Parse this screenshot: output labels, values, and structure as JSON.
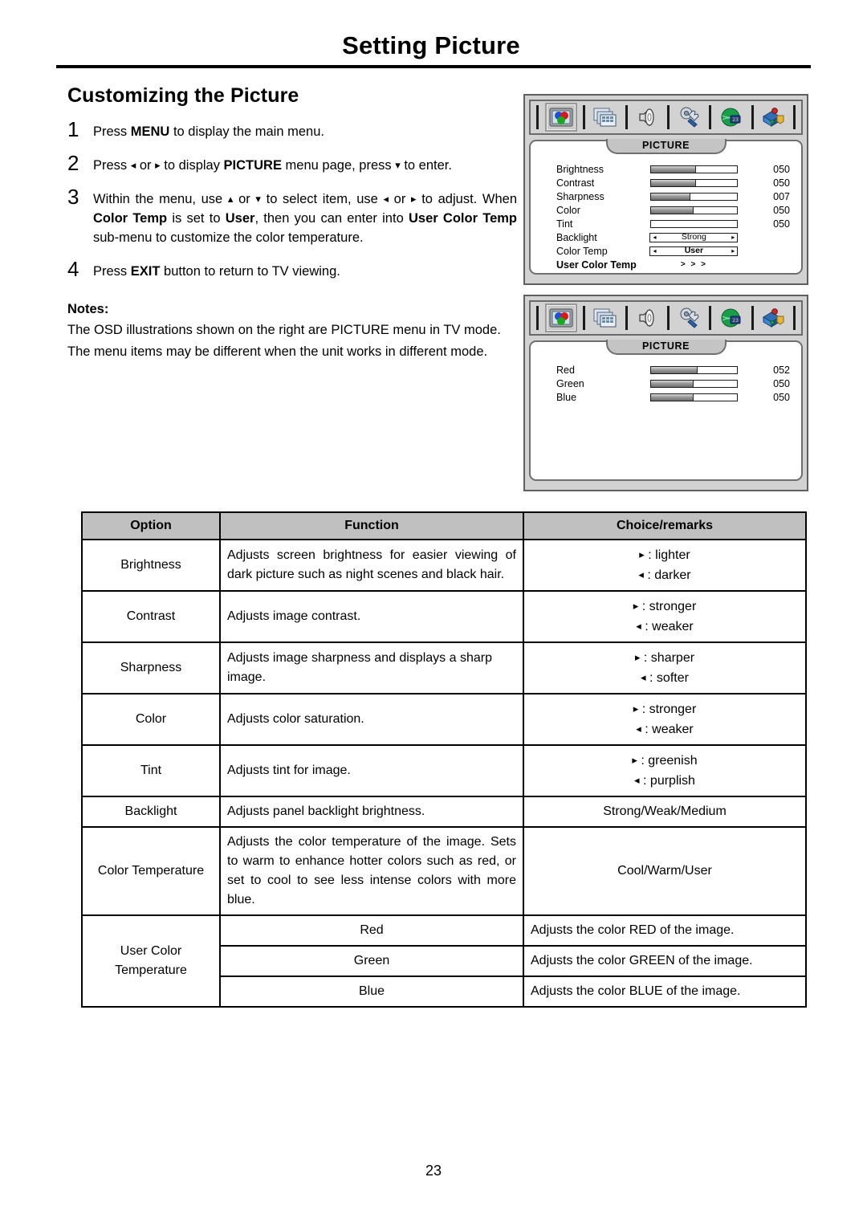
{
  "header": {
    "title": "Setting Picture"
  },
  "section": {
    "title": "Customizing the Picture"
  },
  "steps": [
    {
      "num": "1",
      "parts": [
        {
          "t": "Press ",
          "b": false
        },
        {
          "t": "MENU",
          "b": true
        },
        {
          "t": " to display the main menu.",
          "b": false
        }
      ]
    },
    {
      "num": "2",
      "parts": [
        {
          "t": "Press ",
          "b": false
        },
        {
          "t": "◂",
          "b": false,
          "arrow": true
        },
        {
          "t": " or ",
          "b": false
        },
        {
          "t": "▸",
          "b": false,
          "arrow": true
        },
        {
          "t": " to display ",
          "b": false
        },
        {
          "t": "PICTURE",
          "b": true
        },
        {
          "t": " menu page, press ",
          "b": false
        },
        {
          "t": "▾",
          "b": false,
          "arrow": true
        },
        {
          "t": " to enter.",
          "b": false
        }
      ]
    },
    {
      "num": "3",
      "parts": [
        {
          "t": "Within the menu, use ",
          "b": false
        },
        {
          "t": "▴",
          "b": false,
          "arrow": true
        },
        {
          "t": " or ",
          "b": false
        },
        {
          "t": "▾",
          "b": false,
          "arrow": true
        },
        {
          "t": " to select item, use ",
          "b": false
        },
        {
          "t": "◂",
          "b": false,
          "arrow": true
        },
        {
          "t": " or ",
          "b": false
        },
        {
          "t": "▸",
          "b": false,
          "arrow": true
        },
        {
          "t": " to adjust. When ",
          "b": false
        },
        {
          "t": "Color Temp",
          "b": true
        },
        {
          "t": " is set to ",
          "b": false
        },
        {
          "t": "User",
          "b": true
        },
        {
          "t": ", then you can enter into ",
          "b": false
        },
        {
          "t": "User Color Temp",
          "b": true
        },
        {
          "t": " sub-menu to customize the color temperature.",
          "b": false
        }
      ]
    },
    {
      "num": "4",
      "parts": [
        {
          "t": "Press ",
          "b": false
        },
        {
          "t": "EXIT",
          "b": true
        },
        {
          "t": " button to return to TV viewing.",
          "b": false
        }
      ]
    }
  ],
  "notes": {
    "label": "Notes",
    "lines": [
      "The OSD illustrations shown on the right are PICTURE menu in TV mode.",
      "The menu items may be different when the unit works in different mode."
    ]
  },
  "osd": {
    "icons": [
      {
        "name": "picture-icon",
        "selected": true
      },
      {
        "name": "channel-icon",
        "selected": false
      },
      {
        "name": "sound-icon",
        "selected": false
      },
      {
        "name": "setup-icon",
        "selected": false
      },
      {
        "name": "time-icon",
        "selected": false
      },
      {
        "name": "parental-icon",
        "selected": false
      }
    ],
    "panel1": {
      "tab_label": "PICTURE",
      "rows": [
        {
          "label": "Brightness",
          "type": "slider",
          "fill": 52,
          "value": "050",
          "bold": false
        },
        {
          "label": "Contrast",
          "type": "slider",
          "fill": 52,
          "value": "050",
          "bold": false
        },
        {
          "label": "Sharpness",
          "type": "slider",
          "fill": 46,
          "value": "007",
          "bold": false
        },
        {
          "label": "Color",
          "type": "slider",
          "fill": 50,
          "value": "050",
          "bold": false
        },
        {
          "label": "Tint",
          "type": "slider",
          "fill": 0,
          "value": "050",
          "bold": false
        },
        {
          "label": "Backlight",
          "type": "select",
          "value": "Strong",
          "bold": false,
          "value_bold": false
        },
        {
          "label": "Color Temp",
          "type": "select",
          "value": "User",
          "bold": false,
          "value_bold": true
        },
        {
          "label": "User Color Temp",
          "type": "chevron",
          "value": "> > >",
          "bold": true
        }
      ]
    },
    "panel2": {
      "tab_label": "PICTURE",
      "rows": [
        {
          "label": "Red",
          "type": "slider",
          "fill": 54,
          "value": "052",
          "bold": false
        },
        {
          "label": "Green",
          "type": "slider",
          "fill": 50,
          "value": "050",
          "bold": false
        },
        {
          "label": "Blue",
          "type": "slider",
          "fill": 50,
          "value": "050",
          "bold": false
        }
      ]
    }
  },
  "table": {
    "headers": [
      "Option",
      "Function",
      "Choice/remarks"
    ],
    "rows": [
      {
        "option": "Brightness",
        "function": "Adjusts screen brightness for easier viewing of dark picture such as night scenes and black hair.",
        "justify": true,
        "choices": [
          "▸ : lighter",
          "◂ : darker"
        ]
      },
      {
        "option": "Contrast",
        "function": "Adjusts image contrast.",
        "justify": false,
        "choices": [
          "▸ : stronger",
          "◂ : weaker"
        ]
      },
      {
        "option": "Sharpness",
        "function": "Adjusts image sharpness and displays a sharp image.",
        "justify": false,
        "choices": [
          "▸ : sharper",
          "◂ : softer"
        ]
      },
      {
        "option": "Color",
        "function": "Adjusts color saturation.",
        "justify": false,
        "choices": [
          "▸ : stronger",
          "◂ : weaker"
        ]
      },
      {
        "option": "Tint",
        "function": "Adjusts tint for image.",
        "justify": false,
        "choices": [
          "▸ : greenish",
          "◂ : purplish"
        ]
      },
      {
        "option": "Backlight",
        "function": "Adjusts panel backlight brightness.",
        "justify": false,
        "choices": [
          "Strong/Weak/Medium"
        ]
      },
      {
        "option": "Color Temperature",
        "function": "Adjusts the color temperature of the image. Sets to warm to enhance hotter colors such as red, or set to cool to see less intense colors with more blue.",
        "justify": true,
        "choices": [
          "Cool/Warm/User"
        ]
      }
    ],
    "user_color_group": {
      "label": "User Color Temperature",
      "subrows": [
        {
          "sub": "Red",
          "function": "Adjusts the color RED of the image."
        },
        {
          "sub": "Green",
          "function": "Adjusts the color GREEN of the image."
        },
        {
          "sub": "Blue",
          "function": "Adjusts the color BLUE of the image."
        }
      ]
    }
  },
  "footer": {
    "page_number": "23"
  }
}
